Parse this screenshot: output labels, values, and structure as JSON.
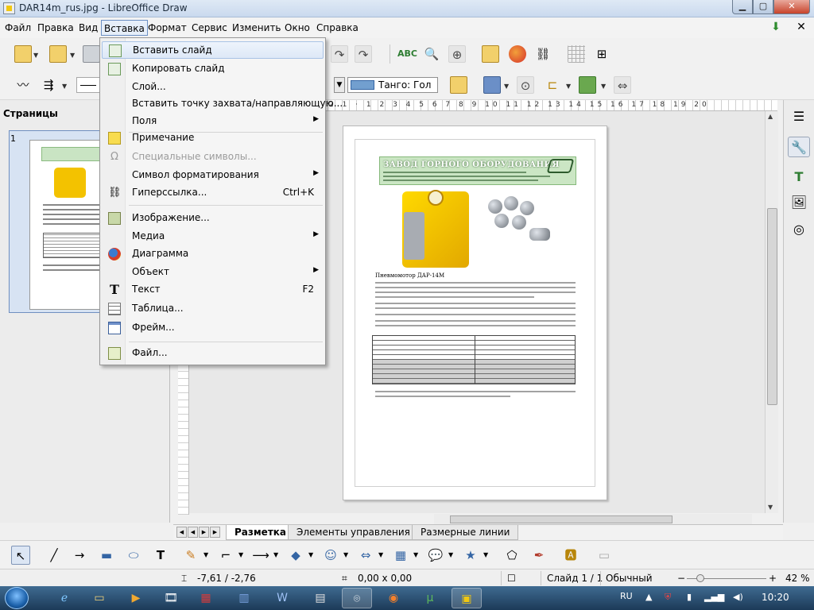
{
  "window": {
    "title": "DAR14m_rus.jpg - LibreOffice Draw",
    "min": "▁",
    "max": "▢",
    "close": "✕"
  },
  "menubar": {
    "items": [
      "Файл",
      "Правка",
      "Вид",
      "Вставка",
      "Формат",
      "Сервис",
      "Изменить",
      "Окно",
      "Справка"
    ],
    "active": "Вставка",
    "close_doc": "✕"
  },
  "toolbar": {
    "fill_style": "Танго: Гол"
  },
  "pages_panel": {
    "title": "Страницы",
    "page_number": "1"
  },
  "ruler": {
    "h_labels": "2 1 · 1 2 3 4 5 6 7 8 9 10 11 12 13 14 15 16 17 18 19 20"
  },
  "insert_menu": {
    "items": [
      {
        "label": "Вставить слайд",
        "icon": "insert-slide-icon",
        "highlighted": true
      },
      {
        "label": "Копировать слайд",
        "icon": "copy-slide-icon"
      },
      {
        "label": "Слой..."
      },
      {
        "label": "Вставить точку захвата/направляющую..."
      },
      {
        "label": "Поля",
        "submenu": true
      },
      {
        "label": "Примечание",
        "icon": "note-icon"
      },
      {
        "label": "Специальные символы...",
        "icon": "omega-icon",
        "disabled": true
      },
      {
        "label": "Символ форматирования",
        "submenu": true
      },
      {
        "label": "Гиперссылка...",
        "icon": "hyperlink-icon",
        "shortcut": "Ctrl+K"
      },
      {
        "label": "Изображение...",
        "icon": "image-icon"
      },
      {
        "label": "Медиа",
        "submenu": true
      },
      {
        "label": "Диаграмма",
        "icon": "chart-icon"
      },
      {
        "label": "Объект",
        "submenu": true
      },
      {
        "label": "Текст",
        "icon": "text-icon",
        "shortcut": "F2"
      },
      {
        "label": "Таблица...",
        "icon": "table-icon"
      },
      {
        "label": "Фрейм...",
        "icon": "frame-icon"
      },
      {
        "label": "Файл...",
        "icon": "file-icon"
      }
    ]
  },
  "document": {
    "company": "ЗАВОД ГОРНОГО ОБОРУДОВАНИЯ",
    "heading": "Пневмомотор ДАР-14М"
  },
  "tabs": [
    "Разметка",
    "Элементы управления",
    "Размерные линии"
  ],
  "tabs_active": "Разметка",
  "status": {
    "position": "-7,61 / -2,76",
    "size": "0,00 x 0,00",
    "slide": "Слайд 1 / 1",
    "layout": "Обычный",
    "zoom_minus": "−",
    "zoom_plus": "+",
    "zoom": "42 %"
  },
  "taskbar": {
    "lang": "RU",
    "time": "10:20"
  },
  "colors": {
    "accent": "#6b8fc3",
    "title_close": "#c7432b"
  }
}
